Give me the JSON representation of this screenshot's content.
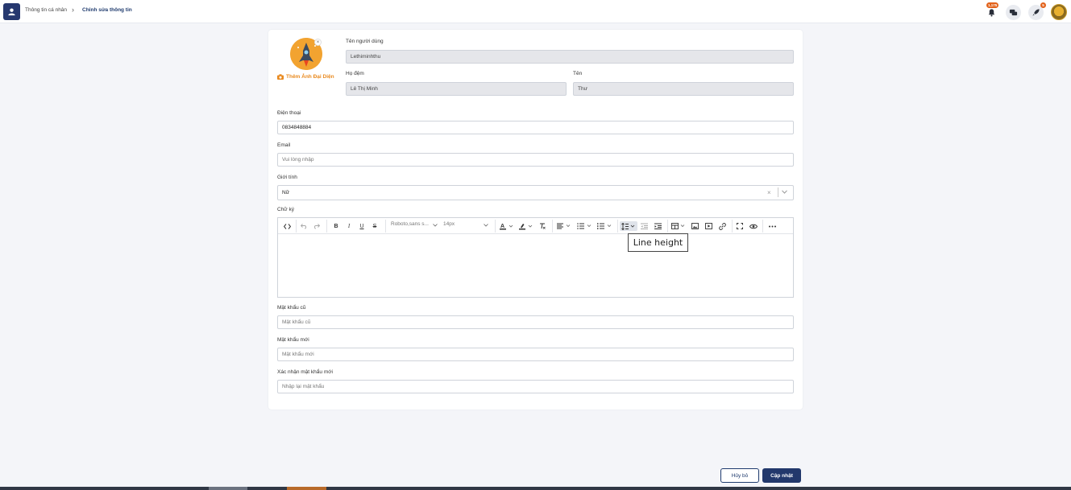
{
  "breadcrumb": {
    "parent": "Thông tin cá nhân",
    "separator": "›",
    "current": "Chỉnh sửa thông tin"
  },
  "header": {
    "notification_count": "1,175",
    "rocket_count": "5"
  },
  "profile": {
    "add_photo_label": "Thêm Ảnh Đại Diện",
    "remove_photo": "×"
  },
  "form": {
    "username": {
      "label": "Tên người dùng",
      "value": "Lethiminhthu"
    },
    "last_name": {
      "label": "Họ đệm",
      "value": "Lê Thị Minh"
    },
    "first_name": {
      "label": "Tên",
      "value": "Thư"
    },
    "phone": {
      "label": "Điện thoại",
      "value": "0834848884"
    },
    "email": {
      "label": "Email",
      "placeholder": "Vui lòng nhập"
    },
    "gender": {
      "label": "Giới tính",
      "value": "Nữ",
      "clear": "×"
    },
    "signature": {
      "label": "Chữ ký"
    },
    "old_password": {
      "label": "Mật khẩu cũ",
      "placeholder": "Mật khẩu cũ"
    },
    "new_password": {
      "label": "Mật khẩu mới",
      "placeholder": "Mật khẩu mới"
    },
    "confirm_password": {
      "label": "Xác nhận mật khẩu mới",
      "placeholder": "Nhập lại mật khẩu"
    }
  },
  "editor": {
    "font_family": "Roboto,sans s...",
    "font_size": "14px",
    "tooltip": "Line height",
    "tools": [
      "code-view",
      "undo",
      "redo",
      "bold",
      "italic",
      "underline",
      "strikethrough",
      "font-family",
      "font-size",
      "text-color",
      "highlight",
      "clear-format",
      "align",
      "ordered-list",
      "unordered-list",
      "line-height",
      "outdent",
      "indent",
      "table",
      "image",
      "video",
      "link",
      "fullscreen",
      "preview",
      "more"
    ]
  },
  "buttons": {
    "cancel": "Hủy bỏ",
    "update": "Cập nhật"
  },
  "colors": {
    "primary": "#22386c",
    "accent": "#e98a1f",
    "badge": "#e2621b"
  }
}
